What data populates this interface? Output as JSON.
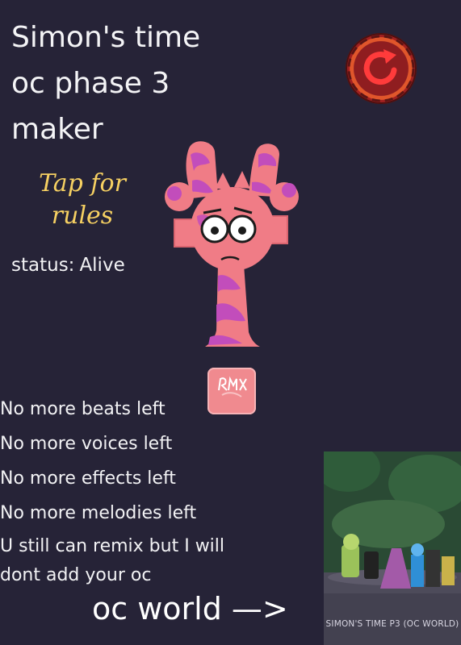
{
  "title_lines": [
    "Simon's time",
    "oc phase 3",
    "maker"
  ],
  "rules_lines": [
    "Tap for",
    "rules"
  ],
  "status": {
    "label": "status:",
    "value": "Alive"
  },
  "notices": [
    "No more beats left",
    "No more voices left",
    "No more effects left",
    "No more melodies left"
  ],
  "remix_note_lines": [
    "U still can remix but I will",
    "dont add your oc"
  ],
  "world_link": "oc world —>",
  "thumbnail": {
    "caption": "SIMON'S TIME P3 (OC WORLD)"
  },
  "icons": {
    "reset": "reset-icon",
    "remix_tile": "rmx-tile-icon"
  },
  "colors": {
    "background": "#262337",
    "rules_text": "#f6d062",
    "reset_button": "#8f1d20",
    "character_pink": "#f07c86",
    "character_purple": "#c24dbb",
    "remix_tile": "#f08a8f"
  }
}
